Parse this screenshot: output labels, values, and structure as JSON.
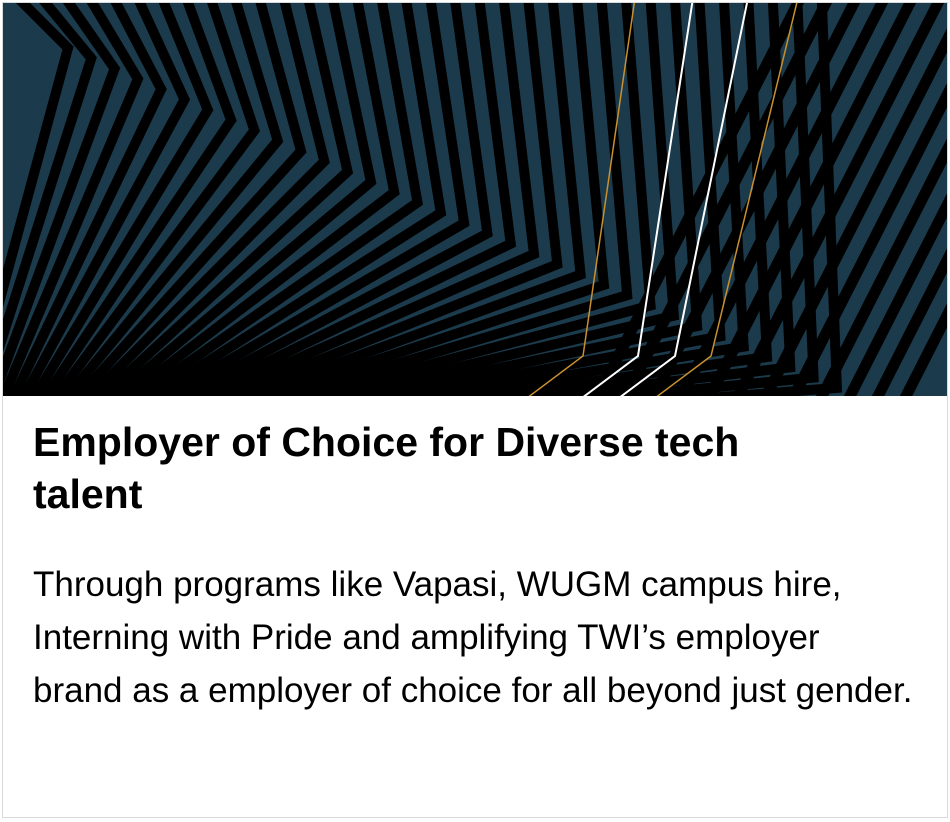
{
  "card": {
    "banner": {
      "image_name": "chevron-stripe-pattern",
      "colors": {
        "background": "#1b3a4b",
        "stripe": "#000000",
        "accent_gold": "#c8902e",
        "accent_white": "#ffffff"
      }
    },
    "title": "Employer of Choice for Diverse tech talent",
    "description": "Through programs like Vapasi, WUGM campus hire, Interning with Pride and amplifying TWI’s employer brand as a employer of choice for all beyond just gender."
  }
}
